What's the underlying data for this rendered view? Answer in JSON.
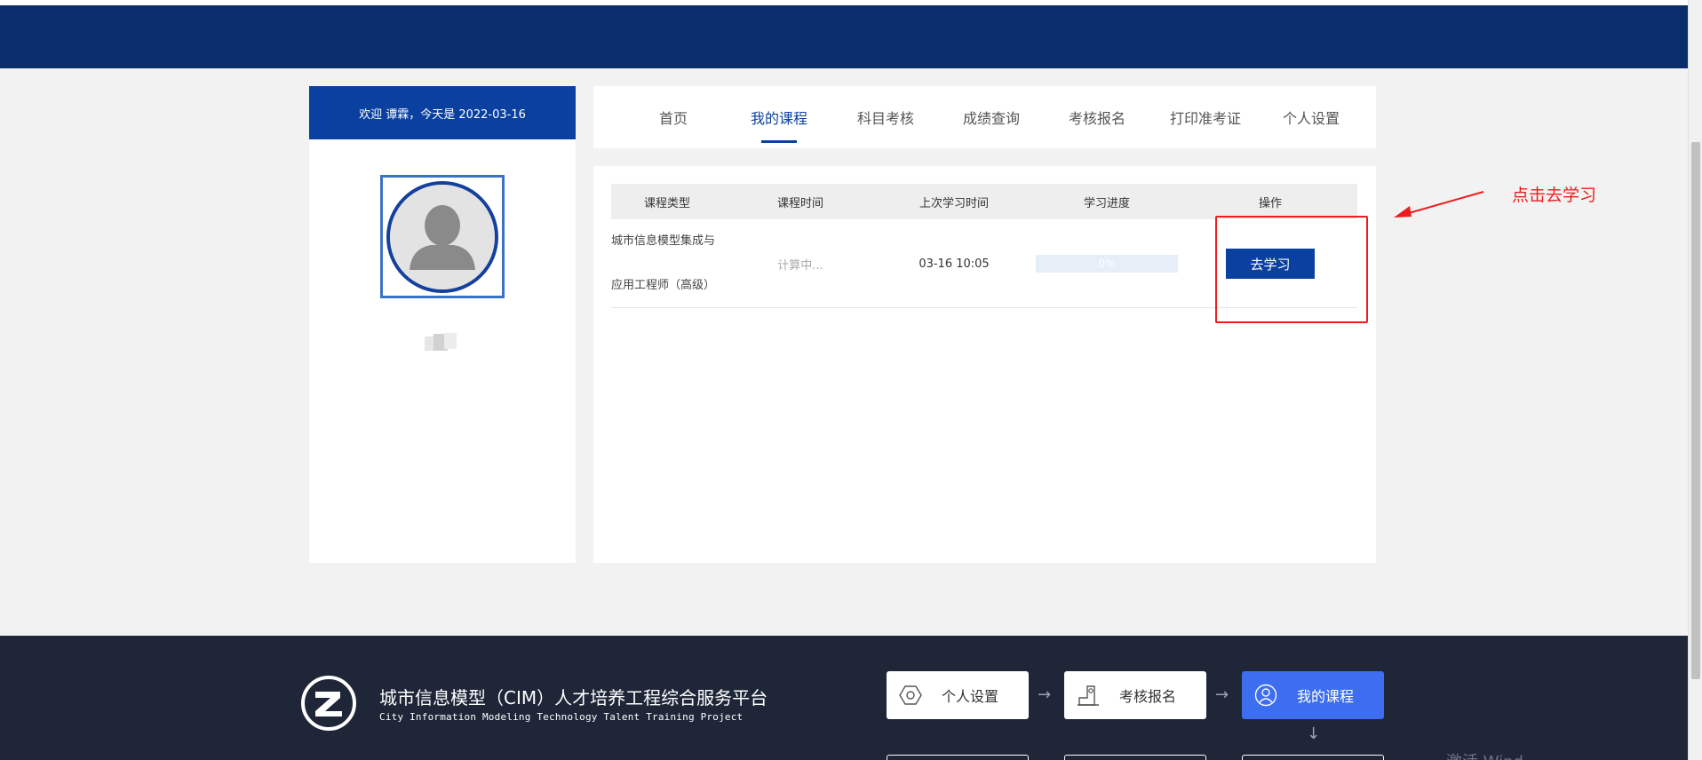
{
  "profile": {
    "welcome": "欢迎 谭霖，今天是 2022-03-16"
  },
  "nav": {
    "tabs": [
      {
        "label": "首页",
        "active": false
      },
      {
        "label": "我的课程",
        "active": true
      },
      {
        "label": "科目考核",
        "active": false
      },
      {
        "label": "成绩查询",
        "active": false
      },
      {
        "label": "考核报名",
        "active": false
      },
      {
        "label": "打印准考证",
        "active": false
      },
      {
        "label": "个人设置",
        "active": false
      }
    ]
  },
  "table": {
    "headers": [
      "课程类型",
      "课程时间",
      "上次学习时间",
      "学习进度",
      "操作"
    ],
    "rows": [
      {
        "name_line1": "城市信息模型集成与",
        "name_line2": "应用工程师（高级）",
        "time": "计算中...",
        "last_study": "03-16 10:05",
        "progress": "0%",
        "progress_value": 0,
        "action": "去学习"
      }
    ]
  },
  "annotation": {
    "text": "点击去学习",
    "color": "#ee1c1c"
  },
  "footer": {
    "title": "城市信息模型（CIM）人才培养工程综合服务平台",
    "subtitle": "City Information Modeling Technology Talent Training Project",
    "steps": [
      {
        "label": "个人设置",
        "icon": "hexagon-icon"
      },
      {
        "label": "考核报名",
        "icon": "form-icon"
      },
      {
        "label": "我的课程",
        "icon": "user-icon"
      }
    ],
    "watermark": "激活 Wind"
  },
  "colors": {
    "brand": "#0a40a0",
    "header": "#0a2d6c",
    "footer": "#1e2638",
    "step_active": "#3d6ef0"
  }
}
